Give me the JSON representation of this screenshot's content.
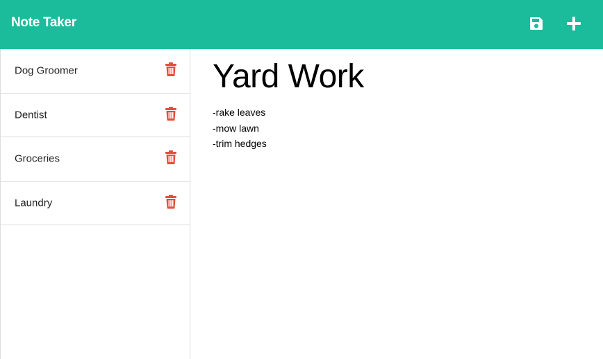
{
  "header": {
    "brand": "Note Taker",
    "save_icon": "save-icon",
    "add_icon": "plus-icon"
  },
  "colors": {
    "accent": "#1abc9c",
    "delete": "#e74c3c"
  },
  "sidebar": {
    "notes": [
      {
        "title": "Dog Groomer",
        "icon": "trash-icon"
      },
      {
        "title": "Dentist",
        "icon": "trash-icon"
      },
      {
        "title": "Groceries",
        "icon": "trash-icon"
      },
      {
        "title": "Laundry",
        "icon": "trash-icon"
      }
    ]
  },
  "editor": {
    "title": "Yard Work",
    "body": "-rake leaves\n-mow lawn\n-trim hedges"
  }
}
